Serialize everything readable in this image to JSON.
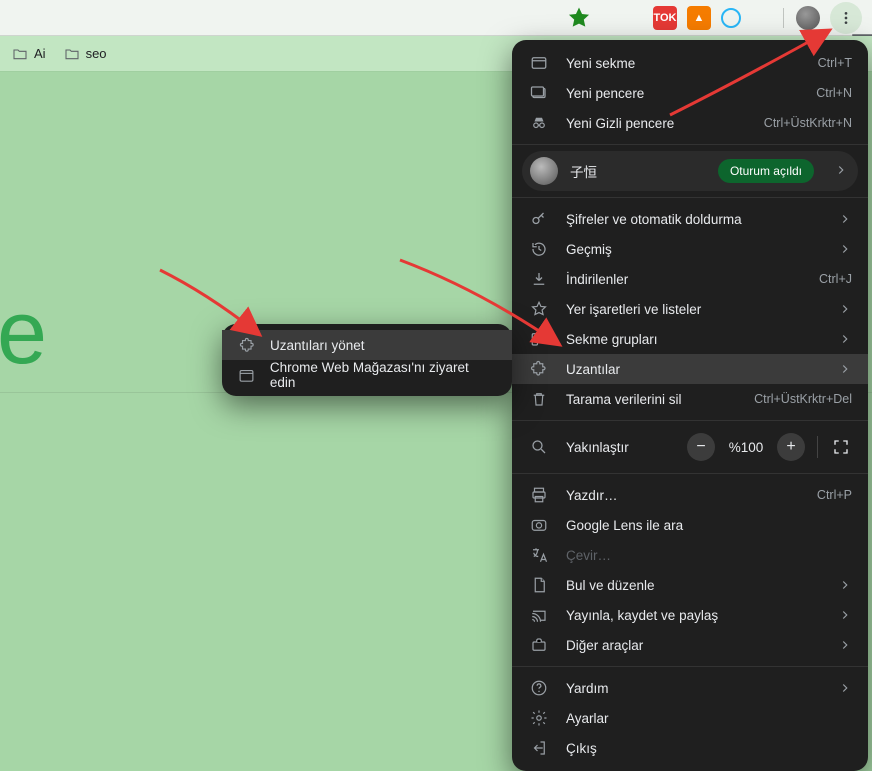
{
  "bookmarks": {
    "items": [
      "Ai",
      "seo"
    ]
  },
  "menu": {
    "new_tab": {
      "label": "Yeni sekme",
      "shortcut": "Ctrl+T"
    },
    "new_window": {
      "label": "Yeni pencere",
      "shortcut": "Ctrl+N"
    },
    "new_incognito": {
      "label": "Yeni Gizli pencere",
      "shortcut": "Ctrl+ÜstKrktr+N"
    },
    "profile": {
      "name": "子恒",
      "status": "Oturum açıldı"
    },
    "passwords": {
      "label": "Şifreler ve otomatik doldurma"
    },
    "history": {
      "label": "Geçmiş"
    },
    "downloads": {
      "label": "İndirilenler",
      "shortcut": "Ctrl+J"
    },
    "bookmarks": {
      "label": "Yer işaretleri ve listeler"
    },
    "tab_groups": {
      "label": "Sekme grupları"
    },
    "extensions": {
      "label": "Uzantılar"
    },
    "clear_data": {
      "label": "Tarama verilerini sil",
      "shortcut": "Ctrl+ÜstKrktr+Del"
    },
    "zoom": {
      "label": "Yakınlaştır",
      "value": "%100"
    },
    "print": {
      "label": "Yazdır…",
      "shortcut": "Ctrl+P"
    },
    "lens": {
      "label": "Google Lens ile ara"
    },
    "translate": {
      "label": "Çevir…"
    },
    "find": {
      "label": "Bul ve düzenle"
    },
    "cast": {
      "label": "Yayınla, kaydet ve paylaş"
    },
    "more_tools": {
      "label": "Diğer araçlar"
    },
    "help": {
      "label": "Yardım"
    },
    "settings": {
      "label": "Ayarlar"
    },
    "exit": {
      "label": "Çıkış"
    }
  },
  "submenu": {
    "manage": "Uzantıları yönet",
    "store": "Chrome Web Mağazası'nı ziyaret edin"
  },
  "toolbar_ext_label": "TOK"
}
